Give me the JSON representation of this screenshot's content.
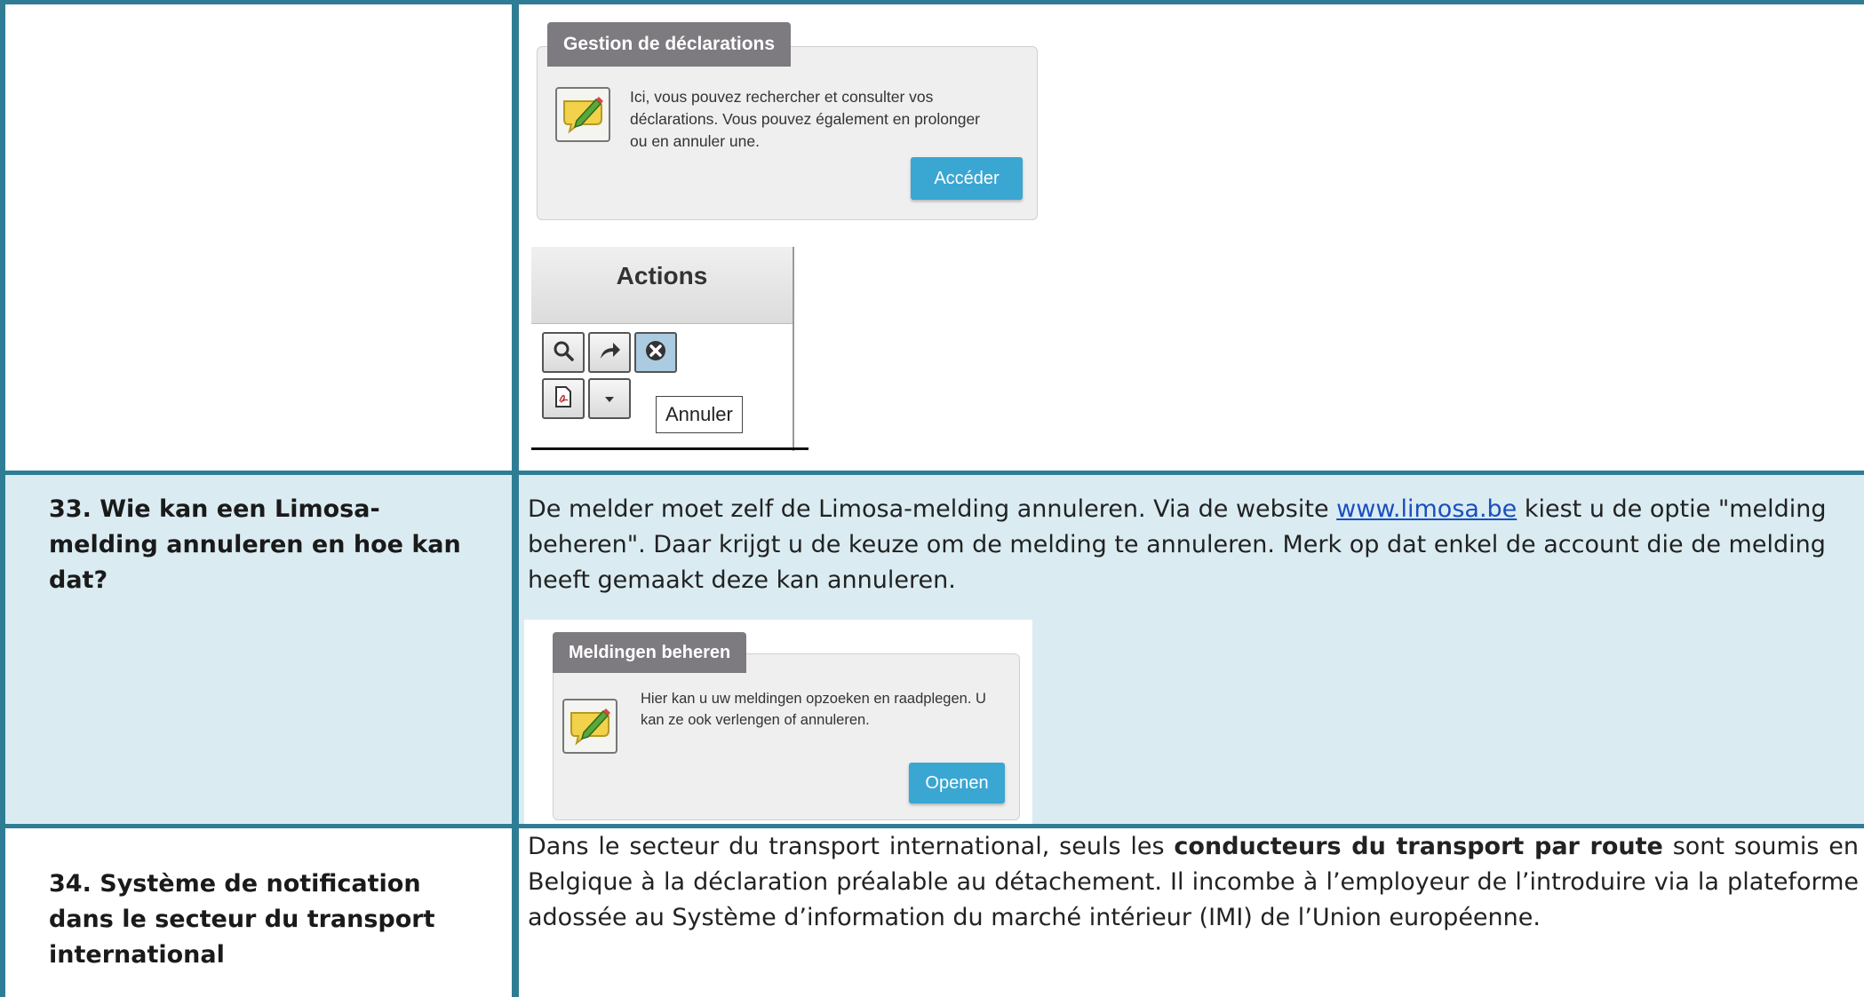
{
  "rows": {
    "top": {
      "widget": {
        "tab_label": "Gestion de déclarations",
        "description": "Ici, vous pouvez rechercher et consulter vos déclarations. Vous pouvez également en prolonger ou en annuler une.",
        "button_label": "Accéder",
        "icon": "notepad-pencil-icon"
      },
      "actions": {
        "header": "Actions",
        "buttons": [
          "search-icon",
          "share-icon",
          "cancel-icon",
          "pdf-icon",
          "dropdown-icon"
        ],
        "tooltip": "Annuler"
      }
    },
    "q33": {
      "question_number": "33.",
      "question": "Wie kan een Limosa-melding annuleren en hoe kan dat?",
      "answer_before_link": "De melder moet zelf de Limosa-melding annuleren. Via de website ",
      "link_text": "www.limosa.be",
      "answer_after_link": " kiest u de optie \"melding beheren\". Daar krijgt u de keuze om de melding te annuleren. Merk op dat enkel de account die de melding heeft gemaakt deze kan annuleren.",
      "widget": {
        "tab_label": "Meldingen beheren",
        "description": "Hier kan u uw meldingen opzoeken en raadplegen. U kan ze ook verlengen of annuleren.",
        "button_label": "Openen",
        "icon": "notepad-pencil-icon"
      }
    },
    "q34": {
      "question_number": "34.",
      "question": "Système de notification dans le secteur du transport international",
      "answer_part1": "Dans le secteur du transport international, seuls les ",
      "answer_bold": "conducteurs du transport par route",
      "answer_part2": " sont soumis en Belgique à la déclaration préalable au détachement. Il incombe à l’employeur de l’introduire via la plateforme adossée au Système d’information du marché intérieur (IMI) de l’Union européenne."
    }
  },
  "colors": {
    "border": "#2f7d95",
    "q33_background": "#daecf2",
    "panel_tab": "#7d7a80",
    "button": "#3aa6d2"
  }
}
